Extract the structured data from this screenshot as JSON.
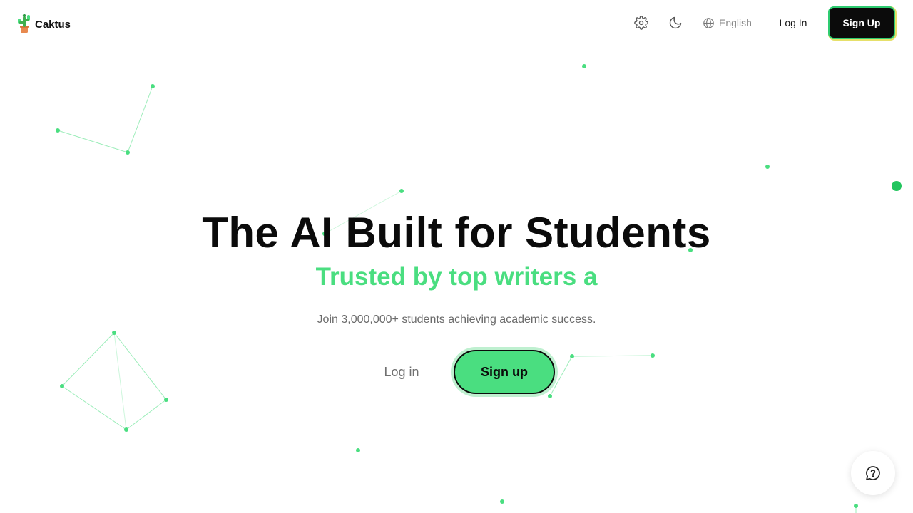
{
  "header": {
    "brand_name": "Caktus",
    "language_label": "English",
    "login_label": "Log In",
    "signup_label": "Sign Up"
  },
  "hero": {
    "title": "The AI Built for Students",
    "subtitle": "Trusted by top writers a",
    "description": "Join 3,000,000+ students achieving academic success.",
    "login_label": "Log in",
    "signup_label": "Sign up"
  },
  "icons": {
    "logo": "cactus-logo-icon",
    "settings": "gear-icon",
    "theme": "moon-icon",
    "language": "globe-icon",
    "help": "chat-question-icon"
  },
  "colors": {
    "accent": "#4ade80",
    "accent_dark": "#22c55e",
    "text": "#0b0b0b",
    "muted": "#6b6b6b"
  }
}
